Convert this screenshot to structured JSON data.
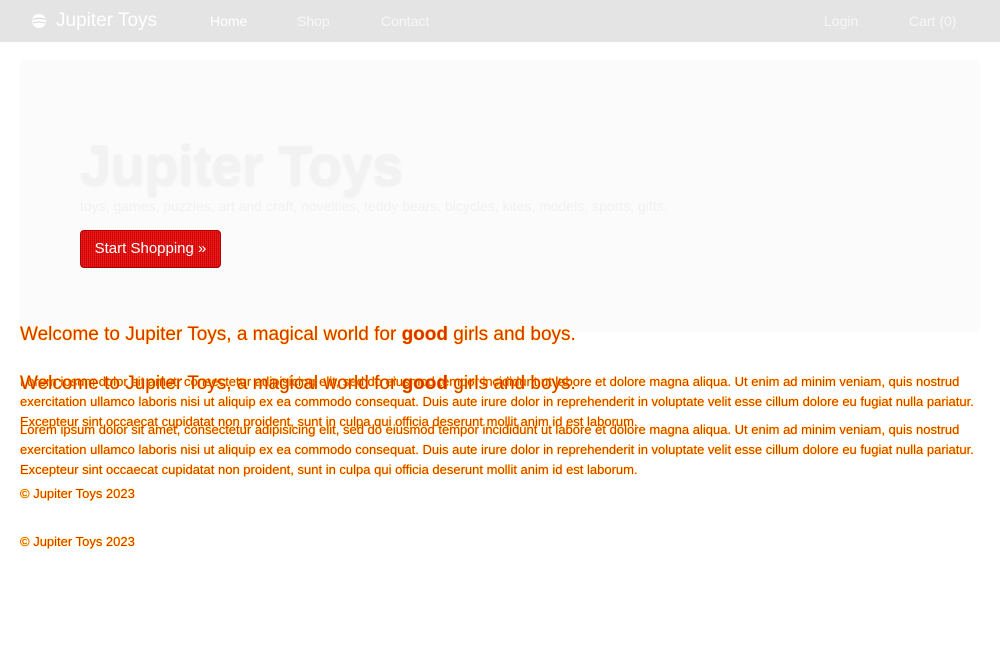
{
  "nav": {
    "brand": "Jupiter Toys",
    "brand_icon": "planet-icon",
    "links": [
      "Home",
      "Shop",
      "Contact"
    ],
    "login": "Login",
    "cart": "Cart (0)"
  },
  "hero": {
    "title": "Jupiter Toys",
    "tagline": "toys, games, puzzles, art and craft, novelties, teddy bears, bicycles, kites, models, sports, gifts.",
    "button": "Start Shopping »"
  },
  "content": {
    "welcome_pre": "Welcome to Jupiter Toys, a magical world for ",
    "welcome_bold": "good",
    "welcome_post": " girls and boys.",
    "lorem": "Lorem ipsum dolor sit amet, consectetur adipisicing elit, sed do eiusmod tempor incididunt ut labore et dolore magna aliqua. Ut enim ad minim veniam, quis nostrud exercitation ullamco laboris nisi ut aliquip ex ea commodo consequat. Duis aute irure dolor in reprehenderit in voluptate velit esse cillum dolore eu fugiat nulla pariatur. Excepteur sint occaecat cupidatat non proident, sunt in culpa qui officia deserunt mollit anim id est laborum.",
    "copyright": "© Jupiter Toys 2023"
  },
  "colors": {
    "navbar": "#e4e4e4",
    "hero_bg": "#fbfbfb",
    "button": "#e80000",
    "text": "#e03000",
    "text_halo": "#ffe600"
  }
}
